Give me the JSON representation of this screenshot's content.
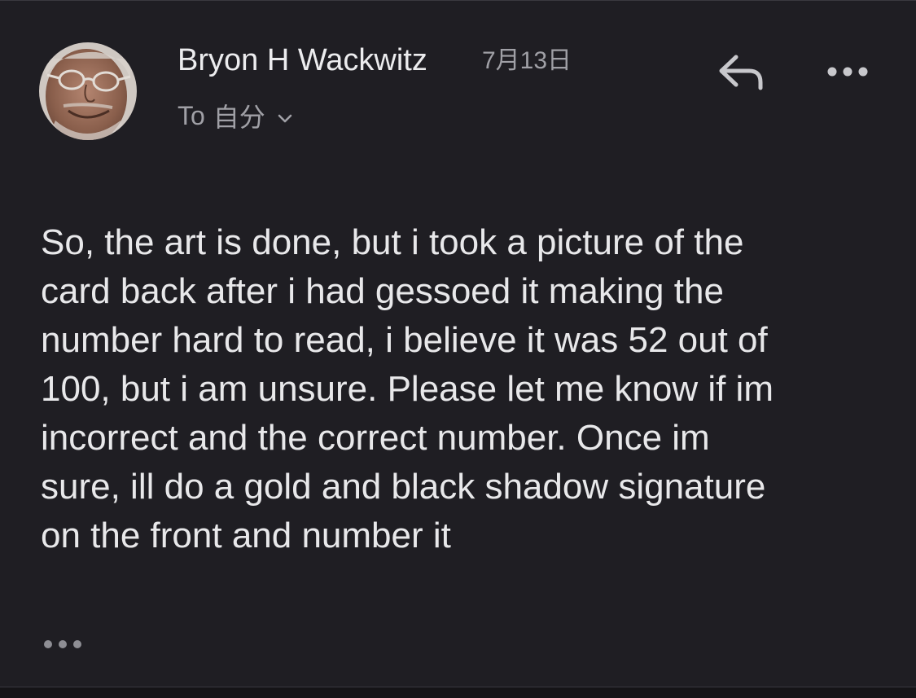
{
  "email": {
    "sender_name": "Bryon H Wackwitz",
    "date": "7月13日",
    "recipient_prefix": "To",
    "recipient": "自分",
    "body": "So, the art is done, but i took a picture of the\ncard back after i had gessoed it making the\nnumber hard to read, i believe it was 52 out of\n100, but i am unsure. Please let me know if im\nincorrect and the correct number. Once im\nsure, ill do a gold and black shadow signature\non the front and number it"
  },
  "icons": {
    "reply": "reply-arrow-icon",
    "more": "more-horizontal-icon",
    "expand_recipients": "chevron-down-icon",
    "trimmed_content": "ellipsis-icon"
  },
  "colors": {
    "background": "#1f1e23",
    "primary_text": "#ececee",
    "secondary_text": "#a0a0a6",
    "icon": "#c8c8cc"
  }
}
